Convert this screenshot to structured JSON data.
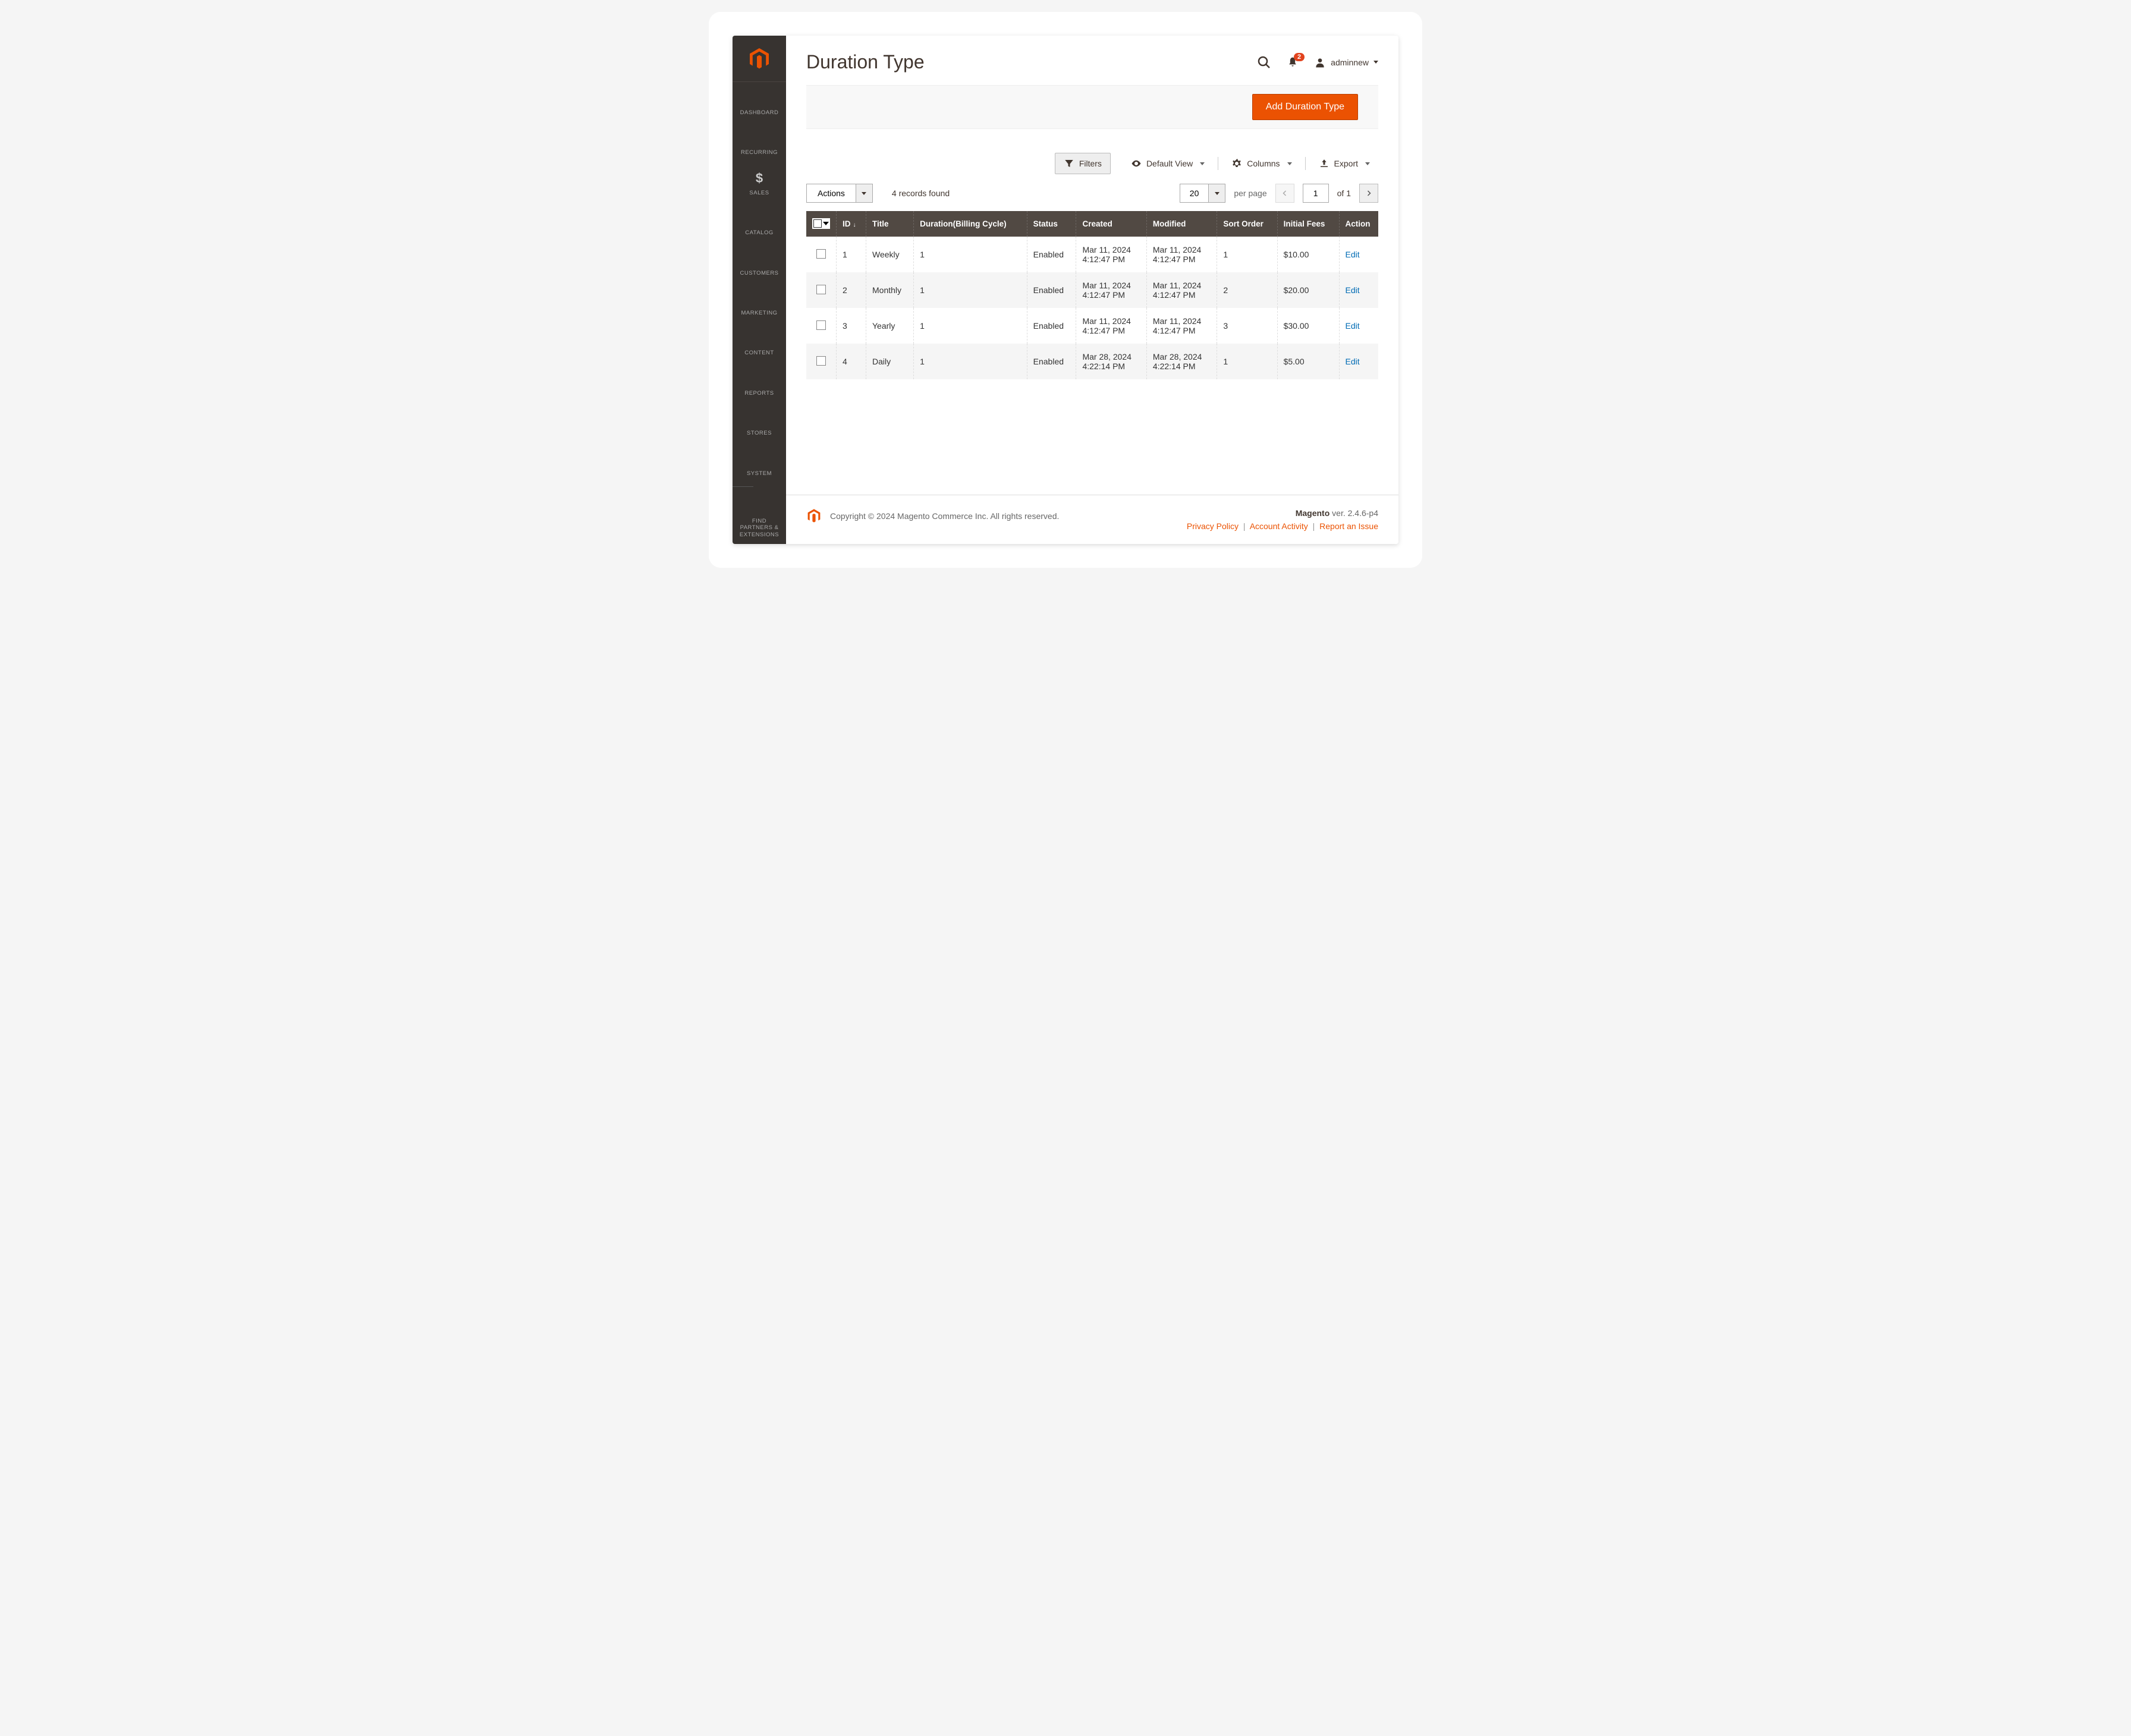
{
  "page_title": "Duration Type",
  "notifications_count": "2",
  "user_name": "adminnew",
  "add_button": "Add Duration Type",
  "toolbar": {
    "filters": "Filters",
    "default_view": "Default View",
    "columns": "Columns",
    "export": "Export"
  },
  "controls": {
    "actions": "Actions",
    "records_found": "4 records found",
    "per_page_value": "20",
    "per_page_label": "per page",
    "current_page": "1",
    "of_total": "of 1"
  },
  "sidebar": [
    {
      "label": "DASHBOARD",
      "icon": "dashboard"
    },
    {
      "label": "RECURRING",
      "icon": "recurring"
    },
    {
      "label": "SALES",
      "icon": "sales"
    },
    {
      "label": "CATALOG",
      "icon": "catalog"
    },
    {
      "label": "CUSTOMERS",
      "icon": "customers"
    },
    {
      "label": "MARKETING",
      "icon": "marketing"
    },
    {
      "label": "CONTENT",
      "icon": "content"
    },
    {
      "label": "REPORTS",
      "icon": "reports"
    },
    {
      "label": "STORES",
      "icon": "stores"
    },
    {
      "label": "SYSTEM",
      "icon": "system"
    },
    {
      "label": "FIND PARTNERS & EXTENSIONS",
      "icon": "partners"
    }
  ],
  "columns": [
    "",
    "ID",
    "Title",
    "Duration(Billing Cycle)",
    "Status",
    "Created",
    "Modified",
    "Sort Order",
    "Initial Fees",
    "Action"
  ],
  "rows": [
    {
      "id": "1",
      "title": "Weekly",
      "duration": "1",
      "status": "Enabled",
      "created": "Mar 11, 2024 4:12:47 PM",
      "modified": "Mar 11, 2024 4:12:47 PM",
      "sort": "1",
      "fees": "$10.00",
      "action": "Edit"
    },
    {
      "id": "2",
      "title": "Monthly",
      "duration": "1",
      "status": "Enabled",
      "created": "Mar 11, 2024 4:12:47 PM",
      "modified": "Mar 11, 2024 4:12:47 PM",
      "sort": "2",
      "fees": "$20.00",
      "action": "Edit"
    },
    {
      "id": "3",
      "title": "Yearly",
      "duration": "1",
      "status": "Enabled",
      "created": "Mar 11, 2024 4:12:47 PM",
      "modified": "Mar 11, 2024 4:12:47 PM",
      "sort": "3",
      "fees": "$30.00",
      "action": "Edit"
    },
    {
      "id": "4",
      "title": "Daily",
      "duration": "1",
      "status": "Enabled",
      "created": "Mar 28, 2024 4:22:14 PM",
      "modified": "Mar 28, 2024 4:22:14 PM",
      "sort": "1",
      "fees": "$5.00",
      "action": "Edit"
    }
  ],
  "footer": {
    "copyright": "Copyright © 2024 Magento Commerce Inc. All rights reserved.",
    "brand": "Magento",
    "version": " ver. 2.4.6-p4",
    "privacy": "Privacy Policy",
    "activity": " Account Activity",
    "report": "Report an Issue"
  }
}
